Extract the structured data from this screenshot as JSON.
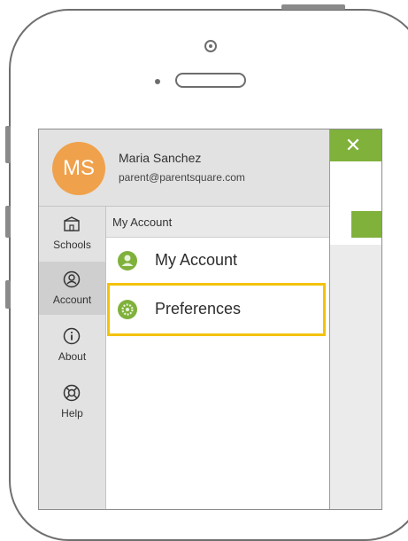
{
  "profile": {
    "initials": "MS",
    "name": "Maria Sanchez",
    "email": "parent@parentsquare.com"
  },
  "nav": [
    {
      "label": "Schools",
      "icon": "school-building-icon",
      "active": false
    },
    {
      "label": "Account",
      "icon": "user-circle-icon",
      "active": true
    },
    {
      "label": "About",
      "icon": "info-icon",
      "active": false
    },
    {
      "label": "Help",
      "icon": "lifebuoy-icon",
      "active": false
    }
  ],
  "section": {
    "title": "My Account"
  },
  "menu": [
    {
      "label": "My Account",
      "icon": "user-icon"
    },
    {
      "label": "Preferences",
      "icon": "gear-icon",
      "highlighted": true
    }
  ],
  "close_symbol": "✕",
  "colors": {
    "brand_green": "#7fb13b",
    "avatar_orange": "#f0a14b",
    "highlight_yellow": "#f4c20d"
  }
}
